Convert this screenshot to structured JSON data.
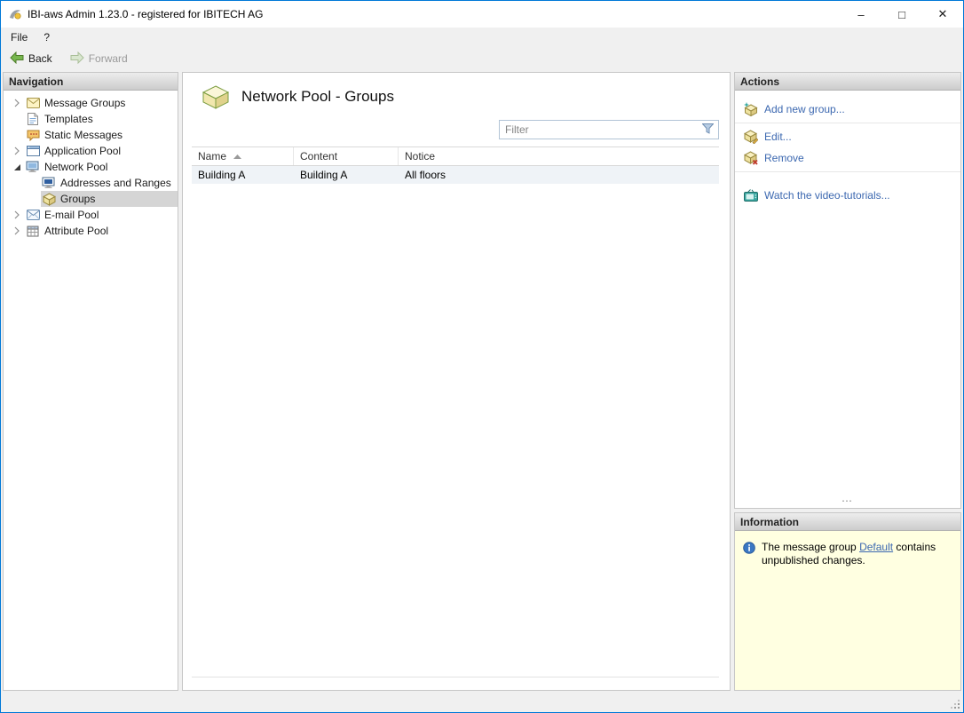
{
  "window": {
    "title": "IBI-aws Admin 1.23.0 - registered for IBITECH AG",
    "controls": {
      "minimize": "–",
      "maximize": "□",
      "close": "✕"
    }
  },
  "menu": {
    "file": "File",
    "help": "?"
  },
  "toolbar": {
    "back": "Back",
    "forward": "Forward"
  },
  "navigation": {
    "header": "Navigation",
    "items": [
      {
        "label": "Message Groups",
        "state": "collapsed"
      },
      {
        "label": "Templates"
      },
      {
        "label": "Static Messages"
      },
      {
        "label": "Application Pool",
        "state": "collapsed"
      },
      {
        "label": "Network Pool",
        "state": "expanded"
      },
      {
        "label": "Addresses and Ranges",
        "parent": "Network Pool"
      },
      {
        "label": "Groups",
        "parent": "Network Pool",
        "selected": true
      },
      {
        "label": "E-mail Pool",
        "state": "collapsed"
      },
      {
        "label": "Attribute Pool",
        "state": "collapsed"
      }
    ]
  },
  "main": {
    "title": "Network Pool - Groups",
    "filter_placeholder": "Filter",
    "table": {
      "columns": [
        "Name",
        "Content",
        "Notice"
      ],
      "sort": {
        "column": "Name",
        "direction": "ascending"
      },
      "rows": [
        [
          "Building A",
          "Building A",
          "All floors"
        ]
      ]
    }
  },
  "actions": {
    "header": "Actions",
    "items": [
      {
        "label": "Add new group..."
      },
      {
        "label": "Edit..."
      },
      {
        "label": "Remove"
      },
      {
        "label": "Watch the video-tutorials..."
      }
    ],
    "splitter_dots": "⋯"
  },
  "information": {
    "header": "Information",
    "text_before": "The message group ",
    "link": "Default",
    "text_after": " contains unpublished changes."
  },
  "colors": {
    "accent": "#0078d7",
    "link": "#3c68b0",
    "info_background": "#ffffe1",
    "selection": "#d5d5d5"
  }
}
